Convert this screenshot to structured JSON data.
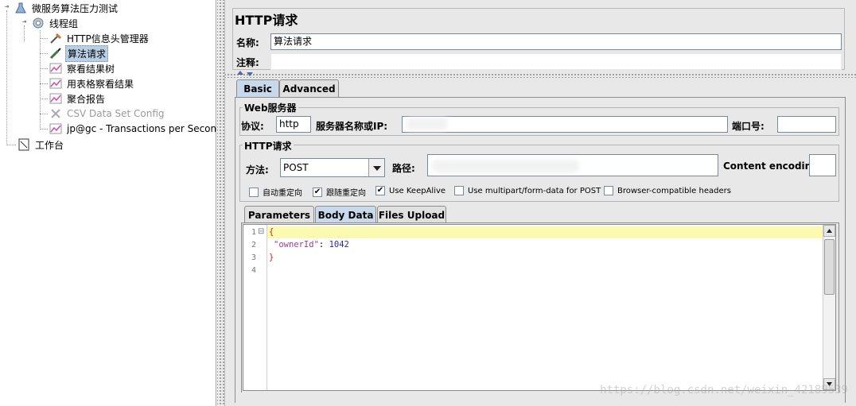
{
  "tree": {
    "root": "微服务算法压力测试",
    "thread_group": "线程组",
    "items": [
      {
        "label": "HTTP信息头管理器",
        "icon": "wrench-icon",
        "selected": false,
        "disabled": false
      },
      {
        "label": "算法请求",
        "icon": "pipette-sampler-icon",
        "selected": true,
        "disabled": false
      },
      {
        "label": "察看结果树",
        "icon": "graph-listener-icon",
        "selected": false,
        "disabled": false
      },
      {
        "label": "用表格察看结果",
        "icon": "graph-listener-icon",
        "selected": false,
        "disabled": false
      },
      {
        "label": "聚合报告",
        "icon": "graph-listener-icon",
        "selected": false,
        "disabled": false
      },
      {
        "label": "CSV Data Set Config",
        "icon": "scissors-config-icon",
        "selected": false,
        "disabled": true
      },
      {
        "label": "jp@gc - Transactions per Second",
        "icon": "graph-listener-icon",
        "selected": false,
        "disabled": false
      }
    ],
    "workbench": "工作台"
  },
  "panel": {
    "title": "HTTP请求",
    "name_label": "名称:",
    "name_value": "算法请求",
    "comment_label": "注释:"
  },
  "tabs": {
    "basic": "Basic",
    "advanced": "Advanced"
  },
  "web_server": {
    "title": "Web服务器",
    "protocol_label": "协议:",
    "protocol_value": "http",
    "server_label": "服务器名称或IP:",
    "port_label": "端口号:"
  },
  "http_request": {
    "title": "HTTP请求",
    "method_label": "方法:",
    "method_value": "POST",
    "path_label": "路径:",
    "encoding_label": "Content encoding:"
  },
  "checkboxes": [
    {
      "label": "自动重定向",
      "checked": false
    },
    {
      "label": "跟随重定向",
      "checked": true
    },
    {
      "label": "Use KeepAlive",
      "checked": true
    },
    {
      "label": "Use multipart/form-data for POST",
      "checked": false
    },
    {
      "label": "Browser-compatible headers",
      "checked": false
    }
  ],
  "subtabs": {
    "parameters": "Parameters",
    "body_data": "Body Data",
    "files_upload": "Files Upload"
  },
  "editor": {
    "line_numbers": [
      "1",
      "2",
      "3",
      "4"
    ],
    "fold_marker": "⊟",
    "lines": [
      "{",
      "\"ownerId\"",
      ": ",
      "1042",
      "}"
    ]
  },
  "watermark": "https://blog.csdn.net/weixin_42189539",
  "colors": {
    "active_tab": "#c7d9ea",
    "string": "#9b3c9b",
    "number": "#2a2ab0",
    "brace": "#d21e1e",
    "highlight_line": "#fafab0"
  }
}
